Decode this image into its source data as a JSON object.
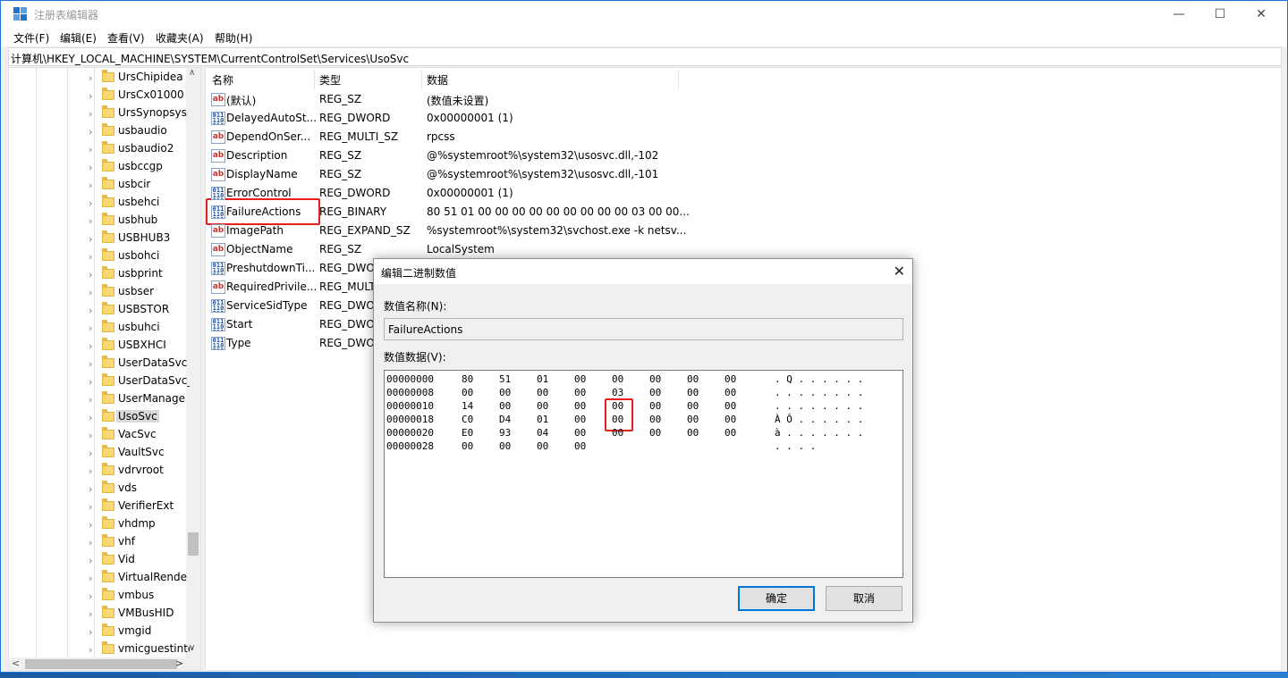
{
  "window": {
    "title": "注册表编辑器",
    "minimize": "—",
    "maximize": "☐",
    "close": "✕"
  },
  "menu": [
    "文件(F)",
    "编辑(E)",
    "查看(V)",
    "收藏夹(A)",
    "帮助(H)"
  ],
  "address": "计算机\\HKEY_LOCAL_MACHINE\\SYSTEM\\CurrentControlSet\\Services\\UsoSvc",
  "tree": {
    "items": [
      "UrsChipidea",
      "UrsCx01000",
      "UrsSynopsys",
      "usbaudio",
      "usbaudio2",
      "usbccgp",
      "usbcir",
      "usbehci",
      "usbhub",
      "USBHUB3",
      "usbohci",
      "usbprint",
      "usbser",
      "USBSTOR",
      "usbuhci",
      "USBXHCI",
      "UserDataSvc",
      "UserDataSvc_",
      "UserManage",
      "UsoSvc",
      "VacSvc",
      "VaultSvc",
      "vdrvroot",
      "vds",
      "VerifierExt",
      "vhdmp",
      "vhf",
      "Vid",
      "VirtualRende",
      "vmbus",
      "VMBusHID",
      "vmgid",
      "vmicguestinte"
    ],
    "selected": "UsoSvc",
    "scroll_up": "∧",
    "scroll_down": "∨",
    "scroll_left": "<",
    "scroll_right": ">"
  },
  "list": {
    "columns": [
      "名称",
      "类型",
      "数据"
    ],
    "rows": [
      {
        "icon": "ab",
        "name": "(默认)",
        "type": "REG_SZ",
        "data": "(数值未设置)"
      },
      {
        "icon": "bin",
        "name": "DelayedAutoSt...",
        "type": "REG_DWORD",
        "data": "0x00000001 (1)"
      },
      {
        "icon": "ab",
        "name": "DependOnSer...",
        "type": "REG_MULTI_SZ",
        "data": "rpcss"
      },
      {
        "icon": "ab",
        "name": "Description",
        "type": "REG_SZ",
        "data": "@%systemroot%\\system32\\usosvc.dll,-102"
      },
      {
        "icon": "ab",
        "name": "DisplayName",
        "type": "REG_SZ",
        "data": "@%systemroot%\\system32\\usosvc.dll,-101"
      },
      {
        "icon": "bin",
        "name": "ErrorControl",
        "type": "REG_DWORD",
        "data": "0x00000001 (1)"
      },
      {
        "icon": "bin",
        "name": "FailureActions",
        "type": "REG_BINARY",
        "data": "80 51 01 00 00 00 00 00 00 00 00 00 03 00 00..."
      },
      {
        "icon": "ab",
        "name": "ImagePath",
        "type": "REG_EXPAND_SZ",
        "data": "%systemroot%\\system32\\svchost.exe -k netsv..."
      },
      {
        "icon": "ab",
        "name": "ObjectName",
        "type": "REG_SZ",
        "data": "LocalSystem"
      },
      {
        "icon": "bin",
        "name": "PreshutdownTi...",
        "type": "REG_DWO",
        "data": ""
      },
      {
        "icon": "ab",
        "name": "RequiredPrivile...",
        "type": "REG_MULT",
        "data": ""
      },
      {
        "icon": "bin",
        "name": "ServiceSidType",
        "type": "REG_DWO",
        "data": ""
      },
      {
        "icon": "bin",
        "name": "Start",
        "type": "REG_DWO",
        "data": ""
      },
      {
        "icon": "bin",
        "name": "Type",
        "type": "REG_DWO",
        "data": ""
      }
    ]
  },
  "dialog": {
    "title": "编辑二进制数值",
    "close": "✕",
    "name_label": "数值名称(N):",
    "name_value": "FailureActions",
    "data_label": "数值数据(V):",
    "hex_rows": [
      {
        "offset": "00000000",
        "bytes": [
          "80",
          "51",
          "01",
          "00",
          "00",
          "00",
          "00",
          "00"
        ],
        "ascii": ". Q . . . . . ."
      },
      {
        "offset": "00000008",
        "bytes": [
          "00",
          "00",
          "00",
          "00",
          "03",
          "00",
          "00",
          "00"
        ],
        "ascii": ". . . . . . . ."
      },
      {
        "offset": "00000010",
        "bytes": [
          "14",
          "00",
          "00",
          "00",
          "00",
          "00",
          "00",
          "00"
        ],
        "ascii": ". . . . . . . ."
      },
      {
        "offset": "00000018",
        "bytes": [
          "C0",
          "D4",
          "01",
          "00",
          "00",
          "00",
          "00",
          "00"
        ],
        "ascii": "À Ô . . . . . ."
      },
      {
        "offset": "00000020",
        "bytes": [
          "E0",
          "93",
          "04",
          "00",
          "00",
          "00",
          "00",
          "00"
        ],
        "ascii": "à . . . . . . ."
      },
      {
        "offset": "00000028",
        "bytes": [
          "00",
          "00",
          "00",
          "00"
        ],
        "ascii": ". . . ."
      }
    ],
    "ok_label": "确定",
    "cancel_label": "取消"
  },
  "colors": {
    "highlight_box": "#e8201c",
    "accent": "#0078d7"
  }
}
